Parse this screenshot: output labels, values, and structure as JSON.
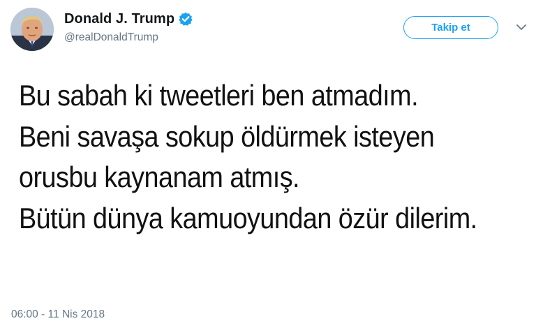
{
  "user": {
    "display_name": "Donald J. Trump",
    "handle": "@realDonaldTrump",
    "verified_icon": "verified-badge-icon"
  },
  "follow_button": {
    "label": "Takip et"
  },
  "menu": {
    "icon": "chevron-down-icon"
  },
  "tweet": {
    "lines": [
      "Bu sabah ki tweetleri ben atmadım.",
      "Beni savaşa sokup öldürmek isteyen",
      "orusbu kaynanam atmış.",
      "Bütün dünya kamuoyundan özür dilerim."
    ],
    "timestamp": "06:00 - 11 Nis 2018"
  },
  "colors": {
    "accent": "#1da1f2",
    "name_text": "#14171a",
    "secondary_text": "#657786"
  }
}
